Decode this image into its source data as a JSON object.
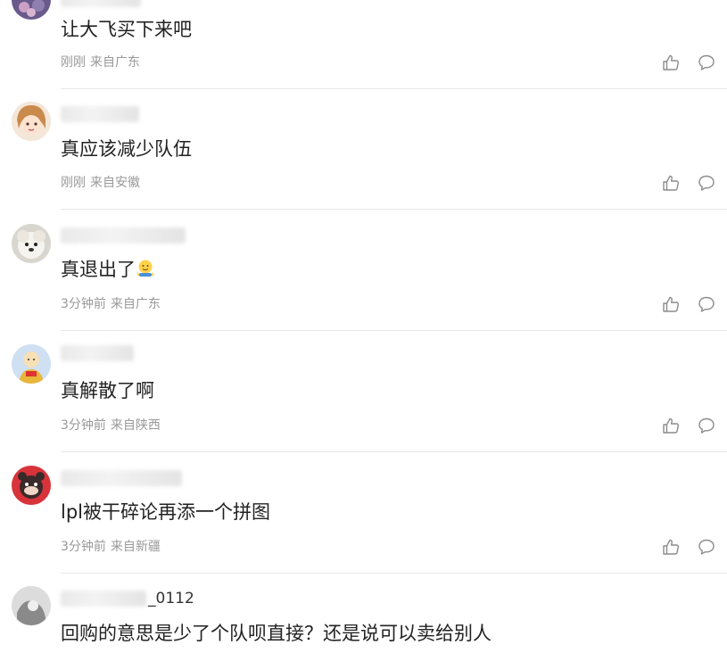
{
  "comments": [
    {
      "username": "",
      "content": "让大飞买下来吧",
      "time": "刚刚",
      "location": "来自广东"
    },
    {
      "username": "",
      "content": "真应该减少队伍",
      "time": "刚刚",
      "location": "来自安徽"
    },
    {
      "username": "",
      "content": "真退出了",
      "emoji": "🫠",
      "time": "3分钟前",
      "location": "来自广东"
    },
    {
      "username": "",
      "content": "真解散了啊",
      "time": "3分钟前",
      "location": "来自陕西"
    },
    {
      "username": "",
      "content": "lpl被干碎论再添一个拼图",
      "time": "3分钟前",
      "location": "来自新疆"
    },
    {
      "username": "_0112",
      "content": "回购的意思是少了个队呗直接？还是说可以卖给别人",
      "time": "",
      "location": ""
    }
  ],
  "icons": {
    "like": "thumbs-up-icon",
    "reply": "comment-bubble-icon"
  },
  "colors": {
    "text": "#222222",
    "meta": "#999999",
    "divider": "#e8e8e8",
    "icon": "#8c8c8c"
  }
}
